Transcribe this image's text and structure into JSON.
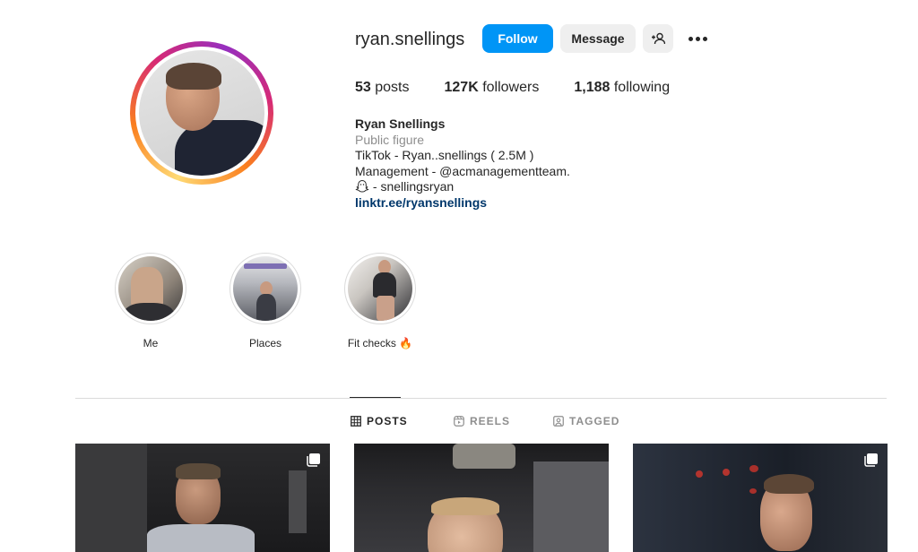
{
  "profile": {
    "username": "ryan.snellings",
    "follow_label": "Follow",
    "message_label": "Message",
    "stats": {
      "posts_count": "53",
      "posts_label": "posts",
      "followers_count": "127K",
      "followers_label": "followers",
      "following_count": "1,188",
      "following_label": "following"
    },
    "bio": {
      "full_name": "Ryan Snellings",
      "category": "Public figure",
      "line1": "TikTok - Ryan..snellings ( 2.5M )",
      "line2": "Management - @acmanagementteam.",
      "line3": " - snellingsryan",
      "link": "linktr.ee/ryansnellings"
    }
  },
  "highlights": [
    {
      "label": "Me"
    },
    {
      "label": "Places"
    },
    {
      "label": "Fit checks 🔥"
    }
  ],
  "tabs": {
    "posts": "POSTS",
    "reels": "REELS",
    "tagged": "TAGGED",
    "active": "posts"
  },
  "colors": {
    "follow_button": "#0095f6",
    "secondary_button": "#efefef",
    "link": "#00376b",
    "muted_text": "#8e8e8e"
  },
  "icons": [
    "add-user-icon",
    "more-options-icon",
    "ghost-icon",
    "grid-icon",
    "reels-icon",
    "tagged-icon",
    "carousel-icon"
  ]
}
